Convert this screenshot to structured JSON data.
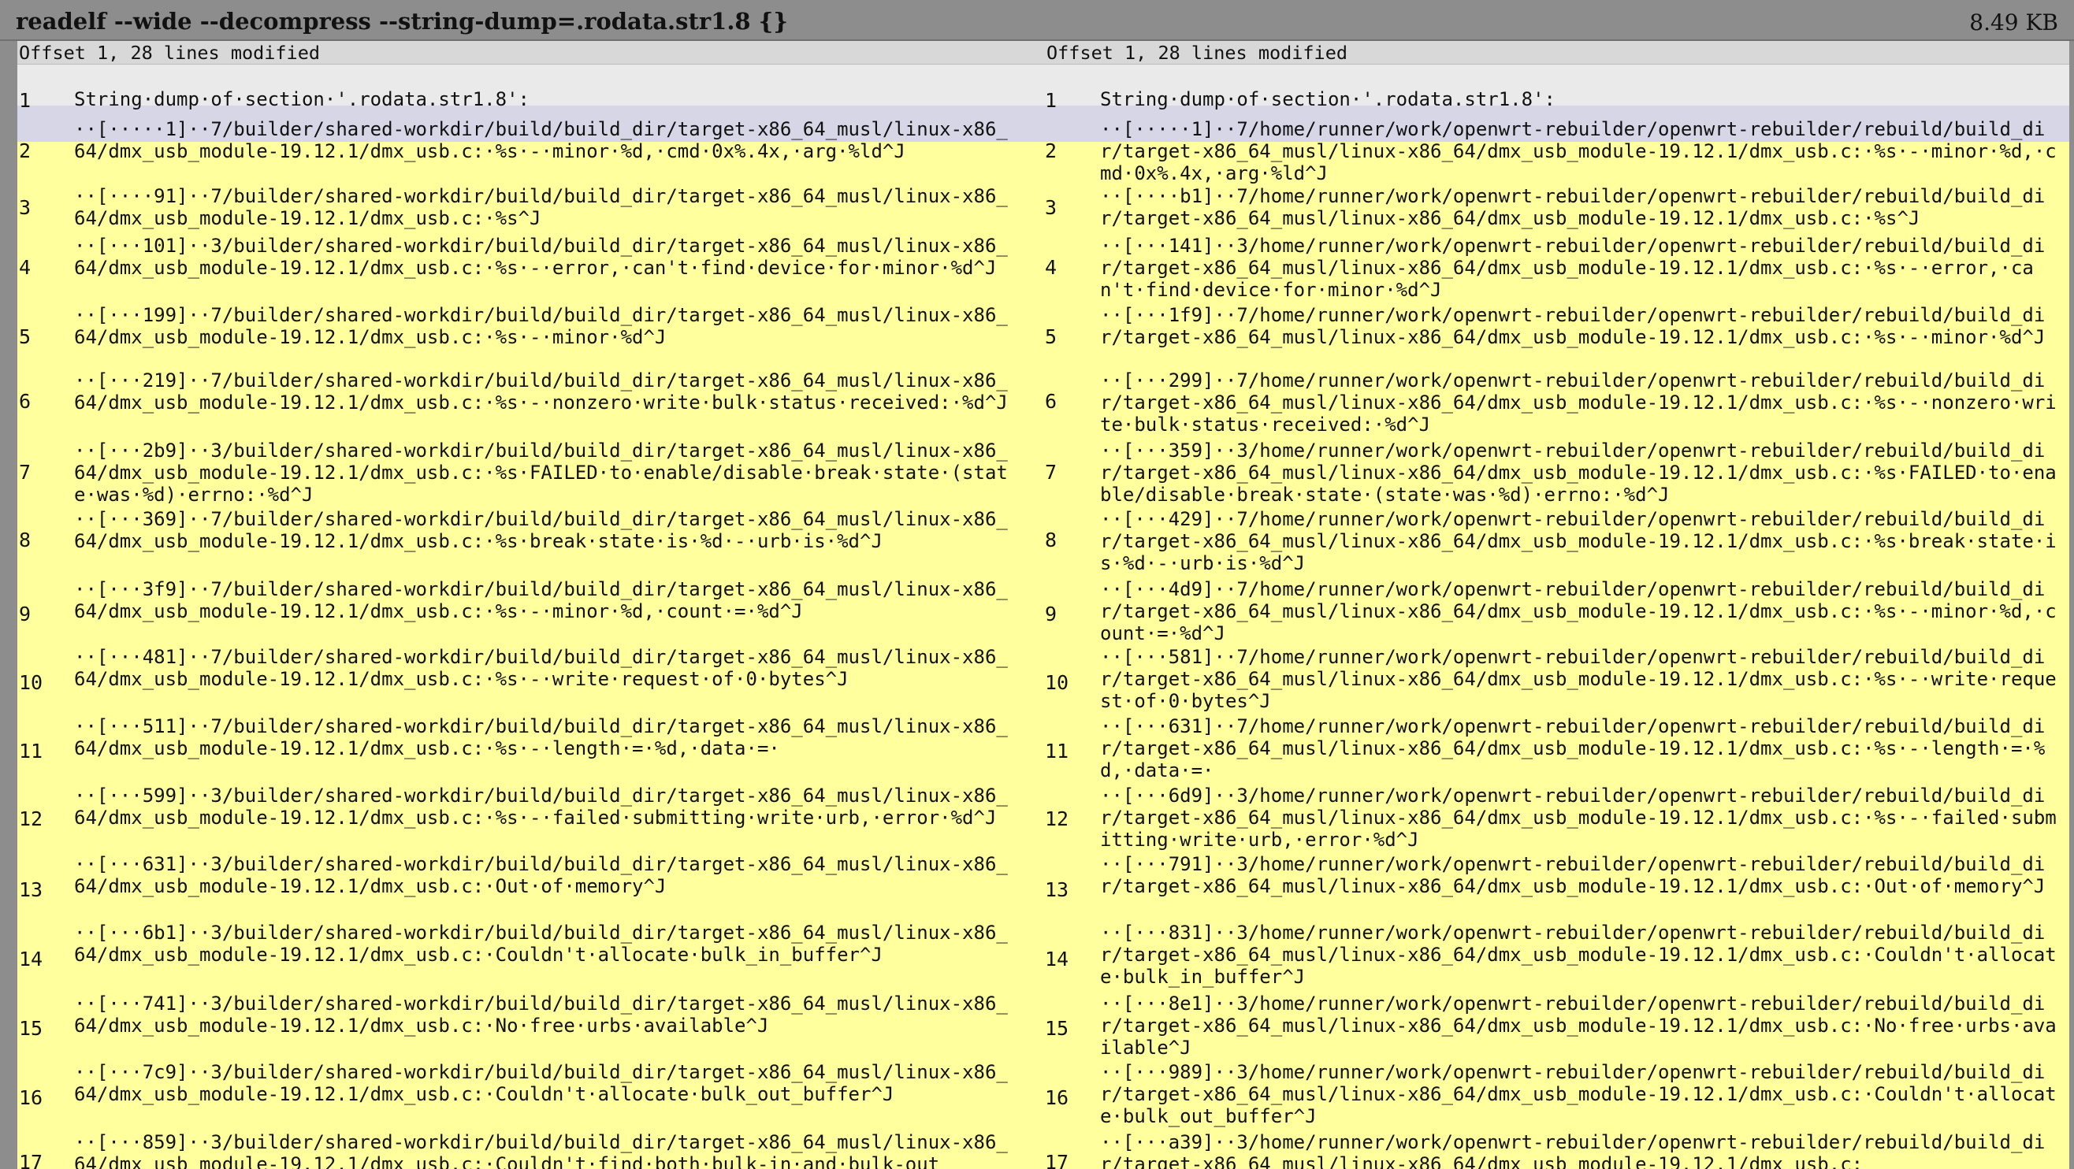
{
  "window": {
    "title": "readelf --wide --decompress --string-dump=.rodata.str1.8 {}",
    "size": "8.49 KB"
  },
  "left": {
    "header": "Offset 1, 28 lines modified"
  },
  "right": {
    "header": "Offset 1, 28 lines modified"
  },
  "rows": [
    {
      "n": "1",
      "l": "String·dump·of·section·'.rodata.str1.8':",
      "r": "String·dump·of·section·'.rodata.str1.8':"
    },
    {
      "n": "2",
      "l": "··[·····1]··7/builder/shared-workdir/build/build_dir/target-x86_64_musl/linux-x86_64/dmx_usb_module-19.12.1/dmx_usb.c:·%s·-·minor·%d,·cmd·0x%.4x,·arg·%ld^J",
      "r": "··[·····1]··7/home/runner/work/openwrt-rebuilder/openwrt-rebuilder/rebuild/build_dir/target-x86_64_musl/linux-x86_64/dmx_usb_module-19.12.1/dmx_usb.c:·%s·-·minor·%d,·cmd·0x%.4x,·arg·%ld^J"
    },
    {
      "n": "3",
      "l": "··[····91]··7/builder/shared-workdir/build/build_dir/target-x86_64_musl/linux-x86_64/dmx_usb_module-19.12.1/dmx_usb.c:·%s^J",
      "r": "··[····b1]··7/home/runner/work/openwrt-rebuilder/openwrt-rebuilder/rebuild/build_dir/target-x86_64_musl/linux-x86_64/dmx_usb_module-19.12.1/dmx_usb.c:·%s^J"
    },
    {
      "n": "4",
      "l": "··[···101]··3/builder/shared-workdir/build/build_dir/target-x86_64_musl/linux-x86_64/dmx_usb_module-19.12.1/dmx_usb.c:·%s·-·error,·can't·find·device·for·minor·%d^J",
      "r": "··[···141]··3/home/runner/work/openwrt-rebuilder/openwrt-rebuilder/rebuild/build_dir/target-x86_64_musl/linux-x86_64/dmx_usb_module-19.12.1/dmx_usb.c:·%s·-·error,·can't·find·device·for·minor·%d^J"
    },
    {
      "n": "5",
      "l": "··[···199]··7/builder/shared-workdir/build/build_dir/target-x86_64_musl/linux-x86_64/dmx_usb_module-19.12.1/dmx_usb.c:·%s·-·minor·%d^J",
      "r": "··[···1f9]··7/home/runner/work/openwrt-rebuilder/openwrt-rebuilder/rebuild/build_dir/target-x86_64_musl/linux-x86_64/dmx_usb_module-19.12.1/dmx_usb.c:·%s·-·minor·%d^J"
    },
    {
      "n": "6",
      "l": "··[···219]··7/builder/shared-workdir/build/build_dir/target-x86_64_musl/linux-x86_64/dmx_usb_module-19.12.1/dmx_usb.c:·%s·-·nonzero·write·bulk·status·received:·%d^J",
      "r": "··[···299]··7/home/runner/work/openwrt-rebuilder/openwrt-rebuilder/rebuild/build_dir/target-x86_64_musl/linux-x86_64/dmx_usb_module-19.12.1/dmx_usb.c:·%s·-·nonzero·write·bulk·status·received:·%d^J"
    },
    {
      "n": "7",
      "l": "··[···2b9]··3/builder/shared-workdir/build/build_dir/target-x86_64_musl/linux-x86_64/dmx_usb_module-19.12.1/dmx_usb.c:·%s·FAILED·to·enable/disable·break·state·(state·was·%d)·errno:·%d^J",
      "r": "··[···359]··3/home/runner/work/openwrt-rebuilder/openwrt-rebuilder/rebuild/build_dir/target-x86_64_musl/linux-x86_64/dmx_usb_module-19.12.1/dmx_usb.c:·%s·FAILED·to·enable/disable·break·state·(state·was·%d)·errno:·%d^J"
    },
    {
      "n": "8",
      "l": "··[···369]··7/builder/shared-workdir/build/build_dir/target-x86_64_musl/linux-x86_64/dmx_usb_module-19.12.1/dmx_usb.c:·%s·break·state·is·%d·-·urb·is·%d^J",
      "r": "··[···429]··7/home/runner/work/openwrt-rebuilder/openwrt-rebuilder/rebuild/build_dir/target-x86_64_musl/linux-x86_64/dmx_usb_module-19.12.1/dmx_usb.c:·%s·break·state·is·%d·-·urb·is·%d^J"
    },
    {
      "n": "9",
      "l": "··[···3f9]··7/builder/shared-workdir/build/build_dir/target-x86_64_musl/linux-x86_64/dmx_usb_module-19.12.1/dmx_usb.c:·%s·-·minor·%d,·count·=·%d^J",
      "r": "··[···4d9]··7/home/runner/work/openwrt-rebuilder/openwrt-rebuilder/rebuild/build_dir/target-x86_64_musl/linux-x86_64/dmx_usb_module-19.12.1/dmx_usb.c:·%s·-·minor·%d,·count·=·%d^J"
    },
    {
      "n": "10",
      "l": "··[···481]··7/builder/shared-workdir/build/build_dir/target-x86_64_musl/linux-x86_64/dmx_usb_module-19.12.1/dmx_usb.c:·%s·-·write·request·of·0·bytes^J",
      "r": "··[···581]··7/home/runner/work/openwrt-rebuilder/openwrt-rebuilder/rebuild/build_dir/target-x86_64_musl/linux-x86_64/dmx_usb_module-19.12.1/dmx_usb.c:·%s·-·write·request·of·0·bytes^J"
    },
    {
      "n": "11",
      "l": "··[···511]··7/builder/shared-workdir/build/build_dir/target-x86_64_musl/linux-x86_64/dmx_usb_module-19.12.1/dmx_usb.c:·%s·-·length·=·%d,·data·=·",
      "r": "··[···631]··7/home/runner/work/openwrt-rebuilder/openwrt-rebuilder/rebuild/build_dir/target-x86_64_musl/linux-x86_64/dmx_usb_module-19.12.1/dmx_usb.c:·%s·-·length·=·%d,·data·=·"
    },
    {
      "n": "12",
      "l": "··[···599]··3/builder/shared-workdir/build/build_dir/target-x86_64_musl/linux-x86_64/dmx_usb_module-19.12.1/dmx_usb.c:·%s·-·failed·submitting·write·urb,·error·%d^J",
      "r": "··[···6d9]··3/home/runner/work/openwrt-rebuilder/openwrt-rebuilder/rebuild/build_dir/target-x86_64_musl/linux-x86_64/dmx_usb_module-19.12.1/dmx_usb.c:·%s·-·failed·submitting·write·urb,·error·%d^J"
    },
    {
      "n": "13",
      "l": "··[···631]··3/builder/shared-workdir/build/build_dir/target-x86_64_musl/linux-x86_64/dmx_usb_module-19.12.1/dmx_usb.c:·Out·of·memory^J",
      "r": "··[···791]··3/home/runner/work/openwrt-rebuilder/openwrt-rebuilder/rebuild/build_dir/target-x86_64_musl/linux-x86_64/dmx_usb_module-19.12.1/dmx_usb.c:·Out·of·memory^J"
    },
    {
      "n": "14",
      "l": "··[···6b1]··3/builder/shared-workdir/build/build_dir/target-x86_64_musl/linux-x86_64/dmx_usb_module-19.12.1/dmx_usb.c:·Couldn't·allocate·bulk_in_buffer^J",
      "r": "··[···831]··3/home/runner/work/openwrt-rebuilder/openwrt-rebuilder/rebuild/build_dir/target-x86_64_musl/linux-x86_64/dmx_usb_module-19.12.1/dmx_usb.c:·Couldn't·allocate·bulk_in_buffer^J"
    },
    {
      "n": "15",
      "l": "··[···741]··3/builder/shared-workdir/build/build_dir/target-x86_64_musl/linux-x86_64/dmx_usb_module-19.12.1/dmx_usb.c:·No·free·urbs·available^J",
      "r": "··[···8e1]··3/home/runner/work/openwrt-rebuilder/openwrt-rebuilder/rebuild/build_dir/target-x86_64_musl/linux-x86_64/dmx_usb_module-19.12.1/dmx_usb.c:·No·free·urbs·available^J"
    },
    {
      "n": "16",
      "l": "··[···7c9]··3/builder/shared-workdir/build/build_dir/target-x86_64_musl/linux-x86_64/dmx_usb_module-19.12.1/dmx_usb.c:·Couldn't·allocate·bulk_out_buffer^J",
      "r": "··[···989]··3/home/runner/work/openwrt-rebuilder/openwrt-rebuilder/rebuild/build_dir/target-x86_64_musl/linux-x86_64/dmx_usb_module-19.12.1/dmx_usb.c:·Couldn't·allocate·bulk_out_buffer^J"
    },
    {
      "n": "17",
      "l": "··[···859]··3/builder/shared-workdir/build/build_dir/target-x86_64_musl/linux-x86_64/dmx_usb_module-19.12.1/dmx_usb.c:·Couldn't·find·both·bulk-in·and·bulk-out",
      "r": "··[···a39]··3/home/runner/work/openwrt-rebuilder/openwrt-rebuilder/rebuild/build_dir/target-x86_64_musl/linux-x86_64/dmx_usb_module-19.12.1/dmx_usb.c:"
    }
  ]
}
